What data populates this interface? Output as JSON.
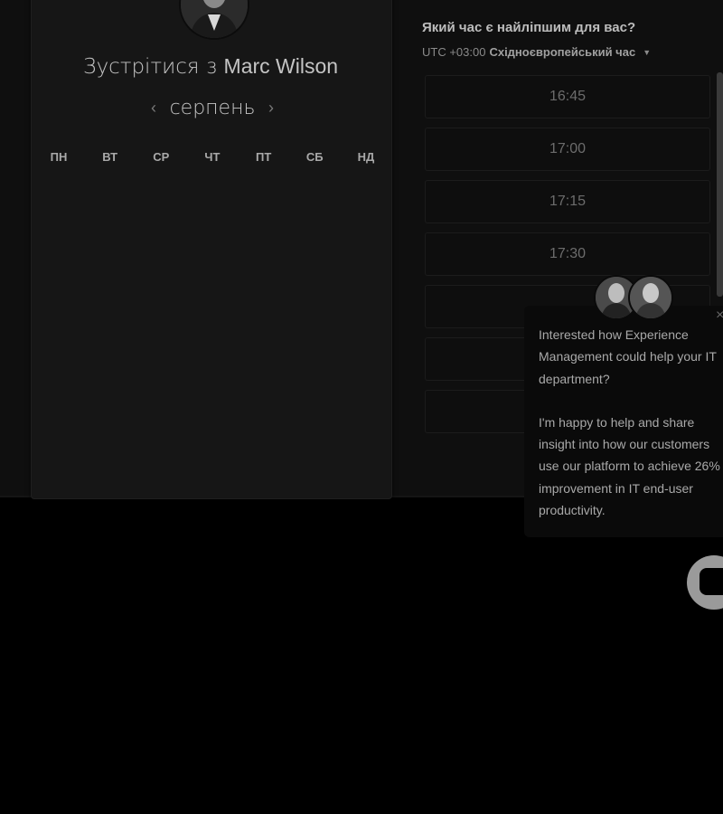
{
  "booking": {
    "meet_prefix": "Зустрітися з",
    "host_name": "Marc Wilson",
    "month": "серпень",
    "weekdays": [
      "ПН",
      "ВТ",
      "СР",
      "ЧТ",
      "ПТ",
      "СБ",
      "НД"
    ]
  },
  "times": {
    "question": "Який час є найліпшим для вас?",
    "tz_offset": "UTC +03:00",
    "tz_name": "Східноєвропейський час",
    "slots": [
      "16:45",
      "17:00",
      "17:15",
      "17:30",
      "",
      "",
      ""
    ]
  },
  "chat": {
    "paragraph1": "Interested how Experience Management could help your IT department?",
    "paragraph2": "I'm happy to help and share insight into how our customers use our platform to achieve 26% improvement in IT end-user productivity.",
    "close_glyph": "×"
  },
  "colors": {
    "background": "#000000",
    "card": "#161616",
    "text": "#bdbdbd"
  }
}
